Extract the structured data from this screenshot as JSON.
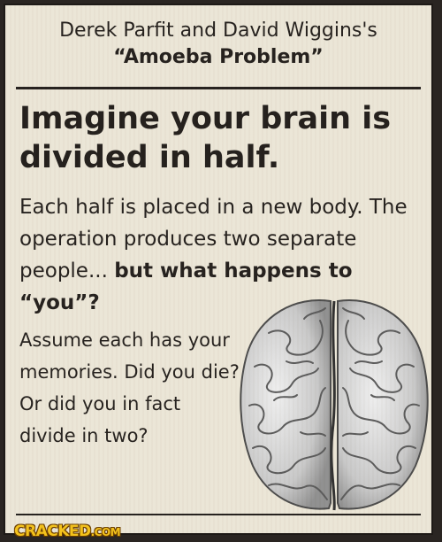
{
  "header": {
    "line1": "Derek Parfit and David Wiggins's",
    "line2": "“Amoeba Problem”"
  },
  "headline": "Imagine your brain is divided in half.",
  "intro": {
    "normal": "Each half is placed in a new body. The operation produces two separate people... ",
    "bold": "but what happens to “you”?"
  },
  "question": "Assume each has your memories. Did you die? Or did you in fact divide in two?",
  "logo": {
    "text": "CRACKED",
    "suffix": ".COM"
  },
  "colors": {
    "background": "#ebe5d6",
    "ink": "#231f1c",
    "logo": "#f4c21a"
  },
  "icons": [
    "brain-icon"
  ]
}
